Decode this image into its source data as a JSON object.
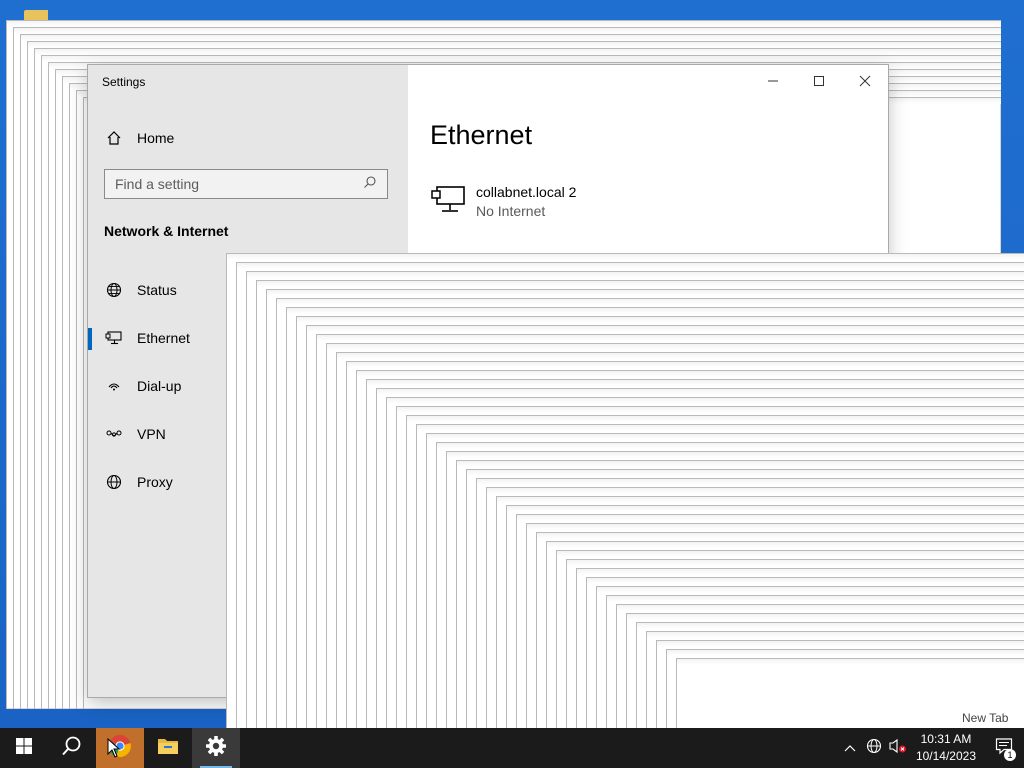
{
  "window": {
    "title": "Settings",
    "controls": {
      "minimize": "─",
      "maximize": "☐",
      "close": "✕"
    }
  },
  "sidebar": {
    "home_label": "Home",
    "search": {
      "placeholder": "Find a setting",
      "value": ""
    },
    "section_title": "Network & Internet",
    "items": [
      {
        "label": "Status",
        "icon": "globe-status-icon",
        "active": false
      },
      {
        "label": "Ethernet",
        "icon": "ethernet-icon",
        "active": true
      },
      {
        "label": "Dial-up",
        "icon": "dialup-icon",
        "active": false
      },
      {
        "label": "VPN",
        "icon": "vpn-icon",
        "active": false
      },
      {
        "label": "Proxy",
        "icon": "globe-icon",
        "active": false
      }
    ]
  },
  "content": {
    "page_title": "Ethernet",
    "network": {
      "name": "collabnet.local 2",
      "status": "No Internet"
    }
  },
  "taskbar": {
    "apps": [
      "start-icon",
      "search-icon",
      "chrome-icon",
      "file-explorer-icon",
      "settings-icon"
    ],
    "clock": {
      "time": "10:31 AM",
      "date": "10/14/2023"
    },
    "notification_count": "1",
    "popup_label": "New Tab"
  },
  "colors": {
    "accent": "#0067c0",
    "sidebar_bg": "#e6e6e6",
    "taskbar_bg": "#1b1b1b"
  }
}
